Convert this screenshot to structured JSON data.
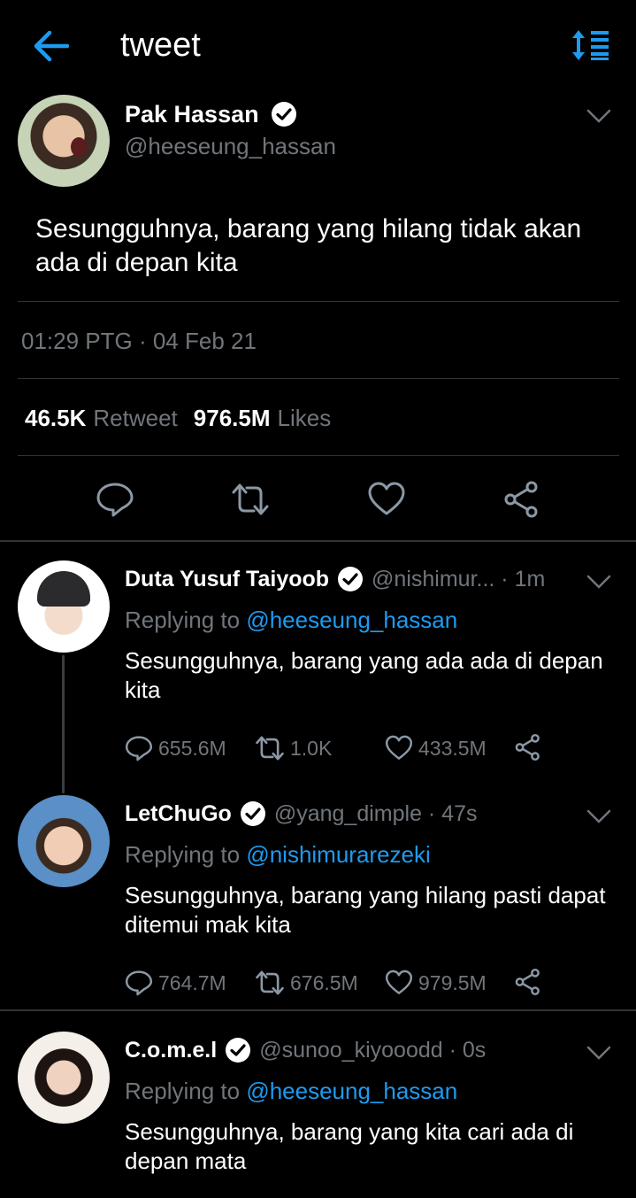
{
  "header": {
    "title": "tweet",
    "back_icon": "arrow-left-icon",
    "sort_icon": "sort-icon"
  },
  "colors": {
    "background": "#000000",
    "accent": "#1d9bf0",
    "muted": "#71767b",
    "divider": "#2f3336"
  },
  "main_tweet": {
    "name": "Pak Hassan",
    "handle": "@heeseung_hassan",
    "text": "Sesungguhnya, barang yang hilang tidak akan ada di depan kita",
    "timestamp": "01:29 PTG · 04 Feb 21",
    "retweet_count": "46.5K",
    "retweet_label": "Retweet",
    "likes_count": "976.5M",
    "likes_label": "Likes"
  },
  "replies": [
    {
      "name": "Duta Yusuf Taiyoob",
      "handle": "@nishimur... · 1m",
      "replying_prefix": "Replying to",
      "replying_to": "@heeseung_hassan",
      "text": "Sesungguhnya, barang yang ada ada di depan kita",
      "replies": "655.6M",
      "retweets": "1.0K",
      "likes": "433.5M"
    },
    {
      "name": "LetChuGo",
      "handle": "@yang_dimple · 47s",
      "replying_prefix": "Replying to",
      "replying_to": "@nishimurarezeki",
      "text": "Sesungguhnya, barang yang hilang pasti dapat ditemui mak kita",
      "replies": "764.7M",
      "retweets": "676.5M",
      "likes": "979.5M"
    },
    {
      "name": "C.o.m.e.l",
      "handle": "@sunoo_kiyooodd · 0s",
      "replying_prefix": "Replying to",
      "replying_to": "@heeseung_hassan",
      "text": "Sesungguhnya, barang yang kita cari ada di depan mata"
    }
  ]
}
